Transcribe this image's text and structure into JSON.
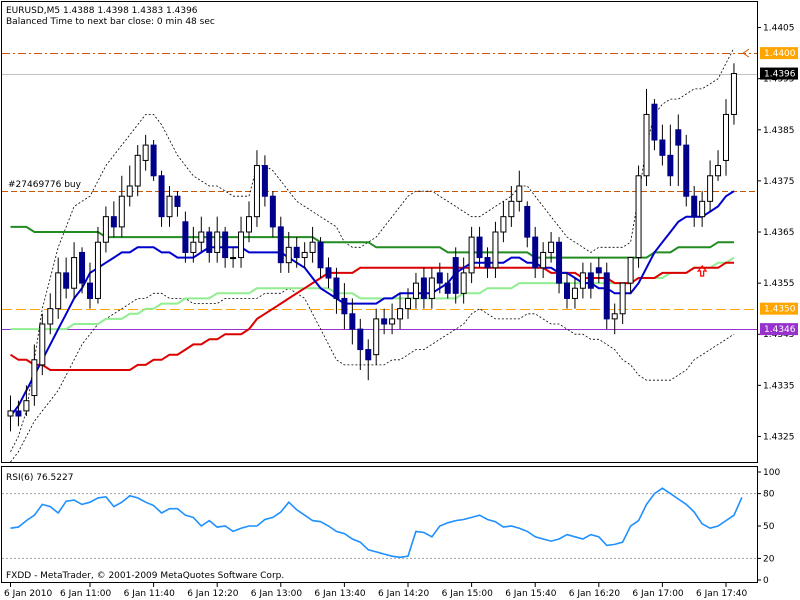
{
  "header": {
    "symbol_line": "EURUSD,M5  1.4388 1.4398 1.4383 1.4396",
    "timer_line": "Balanced Time to next bar close: 0 min 48 sec",
    "order_label": "#27469776 buy",
    "copyright": "FXDD - MetaTrader, © 2001-2009 MetaQuotes Software Corp."
  },
  "price_axis": {
    "ticks": [
      "1.4405",
      "1.4395",
      "1.4385",
      "1.4375",
      "1.4365",
      "1.4355",
      "1.4345",
      "1.4335",
      "1.4325"
    ],
    "tick_values": [
      1.4405,
      1.4395,
      1.4385,
      1.4375,
      1.4365,
      1.4355,
      1.4345,
      1.4335,
      1.4325
    ],
    "tags": [
      {
        "text": "1.4400",
        "value": 1.44,
        "bg": "#ffa500",
        "fg": "#ffffff"
      },
      {
        "text": "1.4396",
        "value": 1.4396,
        "bg": "#000000",
        "fg": "#ffffff"
      },
      {
        "text": "1.4350",
        "value": 1.435,
        "bg": "#ffa500",
        "fg": "#ffffff"
      },
      {
        "text": "1.4346",
        "value": 1.4346,
        "bg": "#9932cc",
        "fg": "#ffffff"
      }
    ]
  },
  "levels": {
    "tp": 1.44,
    "current": 1.4396,
    "order": 1.4373,
    "sl": 1.435,
    "low_mark": 1.4346
  },
  "time_axis": {
    "labels": [
      "6 Jan 2010",
      "6 Jan 11:00",
      "6 Jan 11:40",
      "6 Jan 12:20",
      "6 Jan 13:00",
      "6 Jan 13:40",
      "6 Jan 14:20",
      "6 Jan 15:00",
      "6 Jan 15:40",
      "6 Jan 16:20",
      "6 Jan 17:00",
      "6 Jan 17:40"
    ],
    "bar_index": [
      0,
      10,
      18,
      26,
      34,
      42,
      50,
      58,
      66,
      74,
      82,
      90
    ]
  },
  "rsi_panel": {
    "title": "RSI(6) 76.5227",
    "ticks": [
      "100",
      "80",
      "50",
      "20",
      "0"
    ],
    "tick_values": [
      100,
      80,
      50,
      20,
      0
    ],
    "levels": [
      80,
      20
    ]
  },
  "colors": {
    "bull": "#ffffff",
    "bear": "#00008b",
    "wick": "#000000",
    "ma_fast": "#0000cd",
    "ma_mid": "#dd0000",
    "ma_slow": "#228b22",
    "ma_light": "#90ee90",
    "band": "#000000",
    "rsi": "#1e90ff",
    "order": "#cc5500",
    "tp": "#cc5500",
    "sl": "#ffa500",
    "low_mark": "#9932cc",
    "current": "#c0c0c0",
    "arrow": "#ff0000"
  },
  "chart_data": {
    "type": "candlestick",
    "symbol": "EURUSD",
    "timeframe": "M5",
    "ylim": [
      1.432,
      1.441
    ],
    "close": [
      1.433,
      1.4329,
      1.4332,
      1.434,
      1.4347,
      1.435,
      1.4357,
      1.4354,
      1.436,
      1.4355,
      1.4352,
      1.4363,
      1.4368,
      1.4366,
      1.4372,
      1.4374,
      1.438,
      1.4382,
      1.4376,
      1.4368,
      1.4372,
      1.437,
      1.4361,
      1.4363,
      1.4365,
      1.4361,
      1.4365,
      1.436,
      1.436,
      1.4365,
      1.4368,
      1.4378,
      1.4372,
      1.4366,
      1.4359,
      1.4362,
      1.436,
      1.4361,
      1.4363,
      1.4358,
      1.4356,
      1.4352,
      1.4349,
      1.4346,
      1.4342,
      1.434,
      1.4348,
      1.4347,
      1.4348,
      1.435,
      1.4352,
      1.4355,
      1.4352,
      1.4356,
      1.4355,
      1.4353,
      1.4353,
      1.4357,
      1.4364,
      1.436,
      1.4358,
      1.4365,
      1.4368,
      1.4371,
      1.4374,
      1.4364,
      1.4358,
      1.4361,
      1.4363,
      1.4355,
      1.4352,
      1.4354,
      1.4357,
      1.4354,
      1.4357,
      1.4348,
      1.4349,
      1.4355,
      1.436,
      1.4376,
      1.4388,
      1.4383,
      1.438,
      1.4376,
      1.4382,
      1.4372,
      1.4368,
      1.4371,
      1.4376,
      1.4378,
      1.4388,
      1.4396
    ],
    "open": [
      1.4329,
      1.433,
      1.433,
      1.4333,
      1.4339,
      1.4347,
      1.435,
      1.4357,
      1.4354,
      1.4361,
      1.4355,
      1.4352,
      1.4363,
      1.4368,
      1.4366,
      1.4372,
      1.4374,
      1.4379,
      1.4382,
      1.4376,
      1.4368,
      1.4372,
      1.4367,
      1.4361,
      1.4363,
      1.4365,
      1.4361,
      1.4365,
      1.436,
      1.436,
      1.4365,
      1.4368,
      1.4378,
      1.4372,
      1.4366,
      1.4359,
      1.4362,
      1.436,
      1.4361,
      1.4363,
      1.4358,
      1.4356,
      1.4352,
      1.4349,
      1.4346,
      1.4342,
      1.4341,
      1.4348,
      1.4347,
      1.4348,
      1.435,
      1.4352,
      1.4356,
      1.4352,
      1.4357,
      1.4355,
      1.436,
      1.4353,
      1.4357,
      1.4364,
      1.436,
      1.4358,
      1.4365,
      1.4368,
      1.4371,
      1.437,
      1.4364,
      1.4358,
      1.4361,
      1.4363,
      1.4355,
      1.4352,
      1.4354,
      1.4357,
      1.4358,
      1.4357,
      1.4348,
      1.4349,
      1.4355,
      1.436,
      1.4376,
      1.439,
      1.4383,
      1.438,
      1.4385,
      1.4382,
      1.4372,
      1.4368,
      1.4371,
      1.4376,
      1.4379,
      1.4388
    ],
    "high": [
      1.4333,
      1.4332,
      1.4335,
      1.4343,
      1.4349,
      1.4353,
      1.436,
      1.436,
      1.4363,
      1.4362,
      1.4359,
      1.4366,
      1.437,
      1.4371,
      1.4376,
      1.4378,
      1.4382,
      1.4384,
      1.4383,
      1.4377,
      1.4374,
      1.4373,
      1.4369,
      1.4366,
      1.4368,
      1.4366,
      1.4368,
      1.4366,
      1.4362,
      1.4368,
      1.4371,
      1.4381,
      1.438,
      1.4373,
      1.4368,
      1.4365,
      1.4364,
      1.4363,
      1.4366,
      1.4364,
      1.436,
      1.4358,
      1.4355,
      1.4352,
      1.4348,
      1.4344,
      1.435,
      1.435,
      1.4351,
      1.4353,
      1.4354,
      1.4357,
      1.4358,
      1.4358,
      1.4359,
      1.4357,
      1.4362,
      1.436,
      1.4366,
      1.4366,
      1.4362,
      1.4367,
      1.4371,
      1.4374,
      1.4377,
      1.4371,
      1.4366,
      1.4363,
      1.4365,
      1.4364,
      1.4357,
      1.4356,
      1.4359,
      1.4359,
      1.436,
      1.4359,
      1.4351,
      1.4351,
      1.4357,
      1.4378,
      1.4393,
      1.4391,
      1.4386,
      1.4386,
      1.4388,
      1.4384,
      1.4374,
      1.4373,
      1.4379,
      1.4381,
      1.4391,
      1.4398
    ],
    "low": [
      1.4326,
      1.4327,
      1.4329,
      1.4331,
      1.4337,
      1.4345,
      1.4348,
      1.4352,
      1.4352,
      1.4353,
      1.435,
      1.4351,
      1.4361,
      1.4364,
      1.4364,
      1.437,
      1.4372,
      1.4377,
      1.4375,
      1.4366,
      1.4366,
      1.4368,
      1.4359,
      1.4359,
      1.4361,
      1.4359,
      1.4359,
      1.4358,
      1.4358,
      1.4358,
      1.4363,
      1.4366,
      1.437,
      1.4364,
      1.4357,
      1.4357,
      1.4358,
      1.4358,
      1.4359,
      1.4356,
      1.4354,
      1.4349,
      1.4346,
      1.4343,
      1.4338,
      1.4336,
      1.4339,
      1.4345,
      1.4345,
      1.4346,
      1.4348,
      1.435,
      1.435,
      1.435,
      1.4353,
      1.4352,
      1.4351,
      1.4351,
      1.4355,
      1.4358,
      1.4356,
      1.4356,
      1.4363,
      1.4366,
      1.4369,
      1.4362,
      1.4356,
      1.4356,
      1.4359,
      1.4353,
      1.435,
      1.435,
      1.4352,
      1.4352,
      1.4355,
      1.4346,
      1.4345,
      1.4347,
      1.4353,
      1.4358,
      1.4374,
      1.4381,
      1.4378,
      1.4374,
      1.4374,
      1.437,
      1.4366,
      1.4366,
      1.4369,
      1.4375,
      1.4376,
      1.4386
    ],
    "series": [
      {
        "role": "ma_fast",
        "values": [
          1.4329,
          1.4331,
          1.4334,
          1.4337,
          1.434,
          1.4343,
          1.4346,
          1.4349,
          1.4352,
          1.4354,
          1.4357,
          1.4358,
          1.4359,
          1.436,
          1.4361,
          1.4361,
          1.4362,
          1.4362,
          1.4362,
          1.4361,
          1.4361,
          1.436,
          1.436,
          1.436,
          1.4361,
          1.4362,
          1.4362,
          1.4362,
          1.4362,
          1.4362,
          1.4361,
          1.4361,
          1.4361,
          1.4361,
          1.4361,
          1.436,
          1.4359,
          1.4358,
          1.4356,
          1.4354,
          1.4353,
          1.4352,
          1.4351,
          1.4351,
          1.4351,
          1.4351,
          1.4351,
          1.4352,
          1.4352,
          1.4353,
          1.4353,
          1.4353,
          1.4353,
          1.4353,
          1.4354,
          1.4355,
          1.4357,
          1.4358,
          1.4359,
          1.4359,
          1.4359,
          1.4359,
          1.4359,
          1.436,
          1.436,
          1.4359,
          1.4359,
          1.4358,
          1.4358,
          1.4357,
          1.4357,
          1.4356,
          1.4355,
          1.4355,
          1.4354,
          1.4354,
          1.4353,
          1.4353,
          1.4353,
          1.4355,
          1.4358,
          1.4361,
          1.4363,
          1.4365,
          1.4367,
          1.4368,
          1.4368,
          1.4368,
          1.4369,
          1.437,
          1.4372,
          1.4373
        ]
      },
      {
        "role": "ma_mid",
        "values": [
          1.4341,
          1.434,
          1.434,
          1.4339,
          1.4339,
          1.4338,
          1.4338,
          1.4338,
          1.4338,
          1.4338,
          1.4338,
          1.4338,
          1.4338,
          1.4338,
          1.4338,
          1.4338,
          1.4339,
          1.4339,
          1.434,
          1.434,
          1.4341,
          1.4341,
          1.4342,
          1.4343,
          1.4343,
          1.4344,
          1.4344,
          1.4345,
          1.4345,
          1.4345,
          1.4346,
          1.4348,
          1.4349,
          1.435,
          1.4351,
          1.4352,
          1.4353,
          1.4354,
          1.4355,
          1.4356,
          1.4357,
          1.4357,
          1.4357,
          1.4357,
          1.4358,
          1.4358,
          1.4358,
          1.4358,
          1.4358,
          1.4358,
          1.4358,
          1.4358,
          1.4358,
          1.4358,
          1.4358,
          1.4358,
          1.4358,
          1.4358,
          1.4358,
          1.4358,
          1.4358,
          1.4358,
          1.4358,
          1.4358,
          1.4358,
          1.4358,
          1.4358,
          1.4358,
          1.4357,
          1.4357,
          1.4357,
          1.4357,
          1.4356,
          1.4356,
          1.4356,
          1.4356,
          1.4355,
          1.4355,
          1.4355,
          1.4356,
          1.4356,
          1.4356,
          1.4357,
          1.4357,
          1.4357,
          1.4357,
          1.4358,
          1.4358,
          1.4358,
          1.4358,
          1.4359,
          1.4359
        ]
      },
      {
        "role": "ma_slow",
        "values": [
          1.4366,
          1.4366,
          1.4366,
          1.4365,
          1.4365,
          1.4365,
          1.4365,
          1.4365,
          1.4365,
          1.4365,
          1.4365,
          1.4365,
          1.4364,
          1.4364,
          1.4364,
          1.4364,
          1.4364,
          1.4364,
          1.4364,
          1.4364,
          1.4364,
          1.4364,
          1.4364,
          1.4364,
          1.4364,
          1.4364,
          1.4364,
          1.4364,
          1.4364,
          1.4364,
          1.4364,
          1.4364,
          1.4364,
          1.4364,
          1.4364,
          1.4364,
          1.4364,
          1.4364,
          1.4364,
          1.4363,
          1.4363,
          1.4363,
          1.4363,
          1.4363,
          1.4363,
          1.4363,
          1.4362,
          1.4362,
          1.4362,
          1.4362,
          1.4362,
          1.4362,
          1.4362,
          1.4362,
          1.4362,
          1.4361,
          1.4361,
          1.4361,
          1.4361,
          1.4361,
          1.4361,
          1.4361,
          1.4361,
          1.4361,
          1.4361,
          1.4361,
          1.436,
          1.436,
          1.436,
          1.436,
          1.436,
          1.436,
          1.436,
          1.436,
          1.436,
          1.436,
          1.436,
          1.436,
          1.436,
          1.436,
          1.436,
          1.4361,
          1.4361,
          1.4361,
          1.4362,
          1.4362,
          1.4362,
          1.4362,
          1.4362,
          1.4363,
          1.4363,
          1.4363
        ]
      },
      {
        "role": "ma_light",
        "values": [
          1.4346,
          1.4346,
          1.4346,
          1.4346,
          1.4346,
          1.4346,
          1.4346,
          1.4346,
          1.4347,
          1.4347,
          1.4347,
          1.4347,
          1.4348,
          1.4348,
          1.4348,
          1.4349,
          1.4349,
          1.435,
          1.435,
          1.4351,
          1.4351,
          1.4351,
          1.4352,
          1.4352,
          1.4352,
          1.4352,
          1.4353,
          1.4353,
          1.4353,
          1.4353,
          1.4353,
          1.4354,
          1.4354,
          1.4354,
          1.4354,
          1.4354,
          1.4354,
          1.4354,
          1.4354,
          1.4354,
          1.4354,
          1.4353,
          1.4353,
          1.4353,
          1.4352,
          1.4352,
          1.4352,
          1.4352,
          1.4352,
          1.4352,
          1.4352,
          1.4352,
          1.4352,
          1.4352,
          1.4352,
          1.4352,
          1.4352,
          1.4353,
          1.4353,
          1.4353,
          1.4354,
          1.4354,
          1.4354,
          1.4354,
          1.4355,
          1.4355,
          1.4355,
          1.4355,
          1.4355,
          1.4355,
          1.4355,
          1.4355,
          1.4355,
          1.4355,
          1.4355,
          1.4355,
          1.4355,
          1.4355,
          1.4355,
          1.4356,
          1.4356,
          1.4356,
          1.4356,
          1.4357,
          1.4357,
          1.4357,
          1.4358,
          1.4358,
          1.4358,
          1.4359,
          1.4359,
          1.436
        ]
      },
      {
        "role": "band_upper",
        "values": [
          1.4322,
          1.4325,
          1.433,
          1.434,
          1.435,
          1.4356,
          1.4362,
          1.4366,
          1.437,
          1.4371,
          1.4372,
          1.4375,
          1.4378,
          1.438,
          1.4382,
          1.4384,
          1.4386,
          1.4388,
          1.4388,
          1.4386,
          1.4383,
          1.438,
          1.4378,
          1.4376,
          1.4375,
          1.4374,
          1.4374,
          1.4373,
          1.4372,
          1.4372,
          1.4372,
          1.4378,
          1.4378,
          1.4377,
          1.4375,
          1.4373,
          1.4371,
          1.437,
          1.4369,
          1.4368,
          1.4367,
          1.4366,
          1.4363,
          1.4362,
          1.4362,
          1.4363,
          1.4364,
          1.4366,
          1.4368,
          1.437,
          1.4372,
          1.4373,
          1.4373,
          1.4373,
          1.4372,
          1.4371,
          1.437,
          1.4369,
          1.4368,
          1.4368,
          1.4369,
          1.437,
          1.4371,
          1.4372,
          1.4374,
          1.4374,
          1.4372,
          1.437,
          1.4368,
          1.4366,
          1.4364,
          1.4363,
          1.4362,
          1.4361,
          1.4362,
          1.4362,
          1.4362,
          1.4362,
          1.4363,
          1.4372,
          1.4382,
          1.4388,
          1.439,
          1.4391,
          1.4391,
          1.4392,
          1.4393,
          1.4393,
          1.4394,
          1.4395,
          1.4398,
          1.4401
        ]
      },
      {
        "role": "band_lower",
        "values": [
          1.432,
          1.4322,
          1.4325,
          1.4328,
          1.433,
          1.4332,
          1.4334,
          1.4337,
          1.434,
          1.4343,
          1.4345,
          1.4347,
          1.4348,
          1.4349,
          1.435,
          1.4351,
          1.4352,
          1.4352,
          1.4353,
          1.4353,
          1.4352,
          1.4352,
          1.4352,
          1.4351,
          1.4351,
          1.4351,
          1.4351,
          1.4352,
          1.4352,
          1.4352,
          1.4352,
          1.4352,
          1.4353,
          1.4353,
          1.4353,
          1.4354,
          1.4353,
          1.4352,
          1.4349,
          1.4346,
          1.4343,
          1.434,
          1.4339,
          1.4339,
          1.4339,
          1.4339,
          1.4339,
          1.4339,
          1.434,
          1.434,
          1.4341,
          1.4342,
          1.4342,
          1.4343,
          1.4344,
          1.4345,
          1.4346,
          1.4347,
          1.4349,
          1.435,
          1.4349,
          1.4348,
          1.4348,
          1.4348,
          1.4348,
          1.4349,
          1.4349,
          1.4348,
          1.4347,
          1.4347,
          1.4346,
          1.4345,
          1.4345,
          1.4344,
          1.4344,
          1.4343,
          1.4342,
          1.434,
          1.4339,
          1.4337,
          1.4336,
          1.4336,
          1.4336,
          1.4336,
          1.4337,
          1.4338,
          1.434,
          1.4341,
          1.4342,
          1.4343,
          1.4344,
          1.4345
        ]
      },
      {
        "role": "rsi",
        "values": [
          48,
          49,
          55,
          60,
          70,
          68,
          62,
          73,
          74,
          70,
          72,
          76,
          77,
          68,
          72,
          78,
          76,
          72,
          69,
          62,
          66,
          66,
          60,
          58,
          50,
          55,
          49,
          50,
          45,
          48,
          50,
          50,
          56,
          58,
          63,
          72,
          65,
          60,
          55,
          54,
          50,
          45,
          43,
          38,
          35,
          28,
          26,
          24,
          22,
          21,
          22,
          45,
          44,
          40,
          50,
          53,
          55,
          56,
          58,
          60,
          56,
          54,
          49,
          50,
          48,
          45,
          40,
          38,
          36,
          38,
          42,
          40,
          38,
          42,
          40,
          32,
          33,
          35,
          50,
          55,
          70,
          80,
          85,
          80,
          75,
          70,
          63,
          52,
          48,
          50,
          55,
          60,
          76.5
        ]
      }
    ],
    "rsi_value": 76.5227
  }
}
